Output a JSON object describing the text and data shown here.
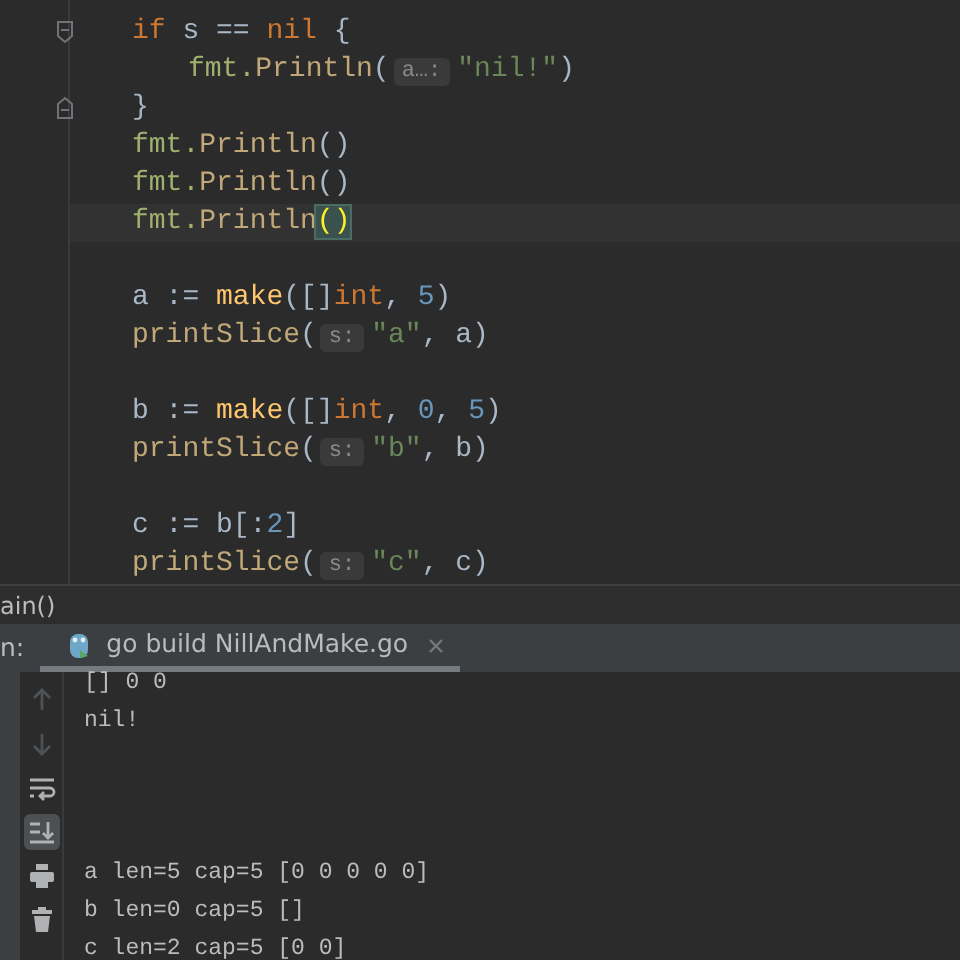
{
  "editor": {
    "lines": [
      {
        "kind": "fold-open",
        "tokens": [
          {
            "kind": "keyword",
            "text": "if"
          },
          {
            "kind": "plain",
            "text": " s == "
          },
          {
            "kind": "keyword",
            "text": "nil"
          },
          {
            "kind": "plain",
            "text": " {"
          }
        ],
        "children": [
          {
            "tokens": [
              {
                "kind": "package",
                "text": "fmt."
              },
              {
                "kind": "func",
                "text": "Println"
              },
              {
                "kind": "plain",
                "text": "("
              },
              {
                "kind": "hint",
                "text": "a…:"
              },
              {
                "kind": "string",
                "text": "\"nil!\""
              },
              {
                "kind": "plain",
                "text": ")"
              }
            ]
          }
        ]
      },
      {
        "kind": "fold-close",
        "tokens": [
          {
            "kind": "plain",
            "text": "}"
          }
        ]
      },
      {
        "tokens": [
          {
            "kind": "package",
            "text": "fmt."
          },
          {
            "kind": "func",
            "text": "Println"
          },
          {
            "kind": "plain",
            "text": "()"
          }
        ]
      },
      {
        "tokens": [
          {
            "kind": "package",
            "text": "fmt."
          },
          {
            "kind": "func",
            "text": "Println"
          },
          {
            "kind": "plain",
            "text": "()"
          }
        ]
      },
      {
        "current": true,
        "tokens": [
          {
            "kind": "package",
            "text": "fmt."
          },
          {
            "kind": "func",
            "text": "Println"
          },
          {
            "kind": "matched",
            "text": "()"
          }
        ]
      },
      {
        "kind": "blank"
      },
      {
        "tokens": [
          {
            "kind": "plain",
            "text": "a := "
          },
          {
            "kind": "builtin",
            "text": "make"
          },
          {
            "kind": "plain",
            "text": "([]"
          },
          {
            "kind": "keyword",
            "text": "int"
          },
          {
            "kind": "plain",
            "text": ", "
          },
          {
            "kind": "number",
            "text": "5"
          },
          {
            "kind": "plain",
            "text": ")"
          }
        ]
      },
      {
        "tokens": [
          {
            "kind": "func",
            "text": "printSlice"
          },
          {
            "kind": "plain",
            "text": "("
          },
          {
            "kind": "hint",
            "text": "s:"
          },
          {
            "kind": "string",
            "text": "\"a\""
          },
          {
            "kind": "plain",
            "text": ", a)"
          }
        ]
      },
      {
        "kind": "blank"
      },
      {
        "tokens": [
          {
            "kind": "plain",
            "text": "b := "
          },
          {
            "kind": "builtin",
            "text": "make"
          },
          {
            "kind": "plain",
            "text": "([]"
          },
          {
            "kind": "keyword",
            "text": "int"
          },
          {
            "kind": "plain",
            "text": ", "
          },
          {
            "kind": "number",
            "text": "0"
          },
          {
            "kind": "plain",
            "text": ", "
          },
          {
            "kind": "number",
            "text": "5"
          },
          {
            "kind": "plain",
            "text": ")"
          }
        ]
      },
      {
        "tokens": [
          {
            "kind": "func",
            "text": "printSlice"
          },
          {
            "kind": "plain",
            "text": "("
          },
          {
            "kind": "hint",
            "text": "s:"
          },
          {
            "kind": "string",
            "text": "\"b\""
          },
          {
            "kind": "plain",
            "text": ", b)"
          }
        ]
      },
      {
        "kind": "blank"
      },
      {
        "tokens": [
          {
            "kind": "plain",
            "text": "c := b[:"
          },
          {
            "kind": "number",
            "text": "2"
          },
          {
            "kind": "plain",
            "text": "]"
          }
        ]
      },
      {
        "tokens": [
          {
            "kind": "func",
            "text": "printSlice"
          },
          {
            "kind": "plain",
            "text": "("
          },
          {
            "kind": "hint",
            "text": "s:"
          },
          {
            "kind": "string",
            "text": "\"c\""
          },
          {
            "kind": "plain",
            "text": ", c)"
          }
        ]
      }
    ]
  },
  "breadcrumb": "ain()",
  "run_panel": {
    "label": "n:",
    "tabs": [
      {
        "label": "go build NillAndMake.go",
        "selected": true
      }
    ],
    "toolbar": [
      {
        "kind": "up",
        "disabled": true,
        "selected": false
      },
      {
        "kind": "down",
        "disabled": true,
        "selected": false
      },
      {
        "kind": "wrap",
        "disabled": false,
        "selected": false
      },
      {
        "kind": "scroll-end",
        "disabled": false,
        "selected": true
      },
      {
        "kind": "print",
        "disabled": false,
        "selected": false
      },
      {
        "kind": "trash",
        "disabled": false,
        "selected": false
      }
    ],
    "output": [
      {
        "kind": "text",
        "text": "[] 0 0"
      },
      {
        "kind": "text",
        "text": "nil!"
      },
      {
        "kind": "blank"
      },
      {
        "kind": "blank"
      },
      {
        "kind": "blank"
      },
      {
        "kind": "text",
        "text": "a len=5 cap=5 [0 0 0 0 0]"
      },
      {
        "kind": "text",
        "text": "b len=0 cap=5 []"
      },
      {
        "kind": "text",
        "text": "c len=2 cap=5 [0 0]"
      }
    ]
  }
}
